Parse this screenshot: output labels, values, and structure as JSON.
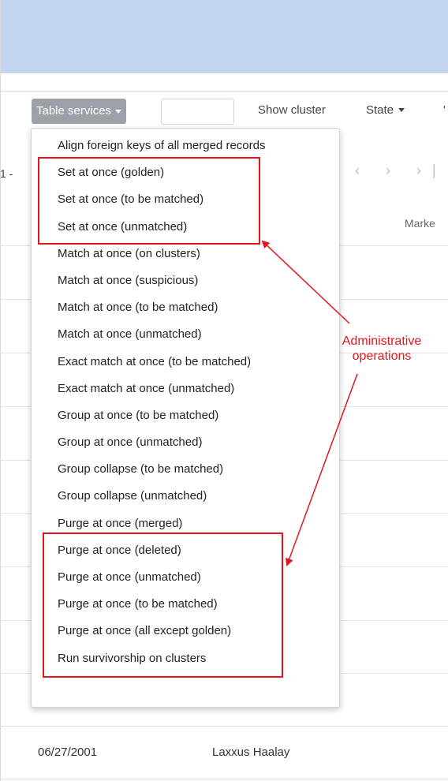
{
  "toolbar": {
    "table_services_label": "Table services",
    "show_cluster_label": "Show cluster",
    "state_label": "State",
    "cut_label": "'"
  },
  "pager": {
    "range_text": "1 -",
    "nav_glyphs": "‹ › ›|"
  },
  "table": {
    "visible_header": "Marke",
    "last_row": {
      "date": "06/27/2001",
      "name": "Laxxus Haalay"
    }
  },
  "menu": {
    "items": [
      "Align foreign keys of all merged records",
      "Set at once (golden)",
      "Set at once (to be matched)",
      "Set at once (unmatched)",
      "Match at once (on clusters)",
      "Match at once (suspicious)",
      "Match at once (to be matched)",
      "Match at once (unmatched)",
      "Exact match at once (to be matched)",
      "Exact match at once (unmatched)",
      "Group at once (to be matched)",
      "Group at once (unmatched)",
      "Group collapse (to be matched)",
      "Group collapse (unmatched)",
      "Purge at once (merged)",
      "Purge at once (deleted)",
      "Purge at once (unmatched)",
      "Purge at once (to be matched)",
      "Purge at once (all except golden)",
      "Run survivorship on clusters"
    ]
  },
  "annotation": {
    "line1": "Administrative",
    "line2": "operations",
    "color": "#e6141e"
  },
  "colors": {
    "banner": "#c3d4ef",
    "button": "#9aa1a8"
  }
}
